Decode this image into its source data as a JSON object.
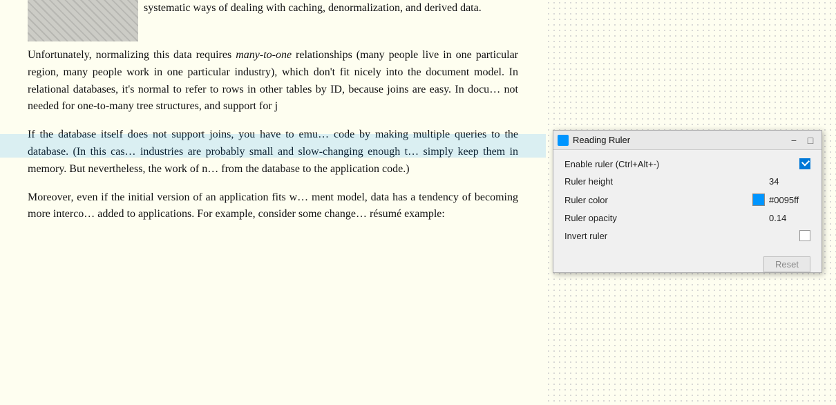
{
  "book": {
    "top_text": "systematic ways of dealing with caching, denormalization, and derived data.",
    "paragraph1": "Unfortunately, normalizing this data requires many-to-one relationships (many people live in one particular region, many people work in one particular industry), which don't fit nicely into the document model. In relational databases, it's normal to refer to rows in other tables by ID, because joins are easy. In docu... not needed for one-to-many tree structures, and support for j",
    "paragraph1_italic": "many-to-one",
    "paragraph2": "If the database itself does not support joins, you have to emu... code by making multiple queries to the database. (In this cas... industries are probably small and slow-changing enough t... simply keep them in memory. But nevertheless, the work of n... from the database to the application code.)",
    "paragraph3": "Moreover, even if the initial version of an application fits w... ment model, data has a tendency of becoming more interco... added to applications. For example, consider some change... résumé example:"
  },
  "ruler_panel": {
    "title": "Reading Ruler",
    "icon_label": "ruler-icon",
    "minimize_label": "−",
    "maximize_label": "□",
    "rows": [
      {
        "label": "Enable ruler (Ctrl+Alt+-)",
        "type": "checkbox",
        "checked": true
      },
      {
        "label": "Ruler height",
        "type": "value",
        "value": "34"
      },
      {
        "label": "Ruler color",
        "type": "color",
        "color": "#0095ff",
        "value": "#0095ff"
      },
      {
        "label": "Ruler opacity",
        "type": "value",
        "value": "0.14"
      },
      {
        "label": "Invert ruler",
        "type": "checkbox",
        "checked": false
      }
    ],
    "reset_label": "Reset"
  }
}
